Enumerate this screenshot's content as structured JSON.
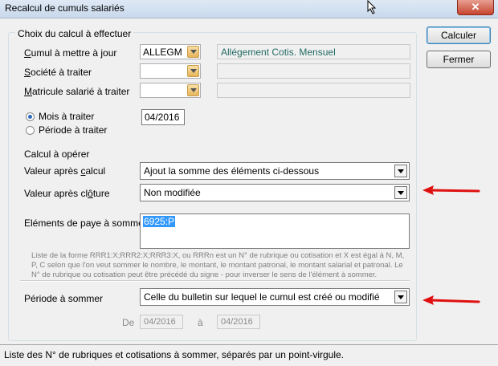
{
  "window": {
    "title": "Recalcul de cumuls salariés",
    "close": "✕"
  },
  "group": {
    "title": "Choix du calcul à effectuer"
  },
  "cumul": {
    "prefix": "C",
    "label": "umul à mettre à jour",
    "value": "ALLEGM",
    "description": "Allégement Cotis. Mensuel"
  },
  "societe": {
    "prefix": "S",
    "label": "ociété à traiter",
    "value": ""
  },
  "matricule": {
    "prefix": "M",
    "label": "atricule salarié à traiter",
    "value": ""
  },
  "radios": {
    "mois": {
      "label": "Mois à traiter",
      "checked": true,
      "value": "04/2016"
    },
    "periode": {
      "label": "Période à traiter",
      "checked": false
    }
  },
  "calcul": {
    "heading": "Calcul à opérer",
    "apres_calcul": {
      "label_a": "Valeur après ",
      "label_u": "c",
      "label_b": "alcul",
      "value": "Ajout la somme des éléments ci-dessous"
    },
    "apres_cloture": {
      "label_a": "Valeur après cl",
      "label_u": "ô",
      "label_b": "ture",
      "value": "Non modifiée"
    }
  },
  "elements": {
    "label": "Eléments de paye à sommer",
    "value": "6925:P",
    "hint": "Liste de la forme RRR1:X;RRR2:X;RRR3:X, ou RRRn est un N° de rubrique ou cotisation et X est égal à N, M, P, C selon que l'on veut sommer le nombre, le montant, le montant patronal, le montant salarial et patronal. Le N° de rubrique ou cotisation peut être précédé du signe - pour inverser le sens de l'élément à sommer."
  },
  "periode_sommer": {
    "label": "Période à sommer",
    "value": "Celle du bulletin sur lequel le cumul est créé ou modifié"
  },
  "range": {
    "de_label": "De",
    "de_value": "04/2016",
    "a_label": "à",
    "a_value": "04/2016"
  },
  "buttons": {
    "calculer": "Calculer",
    "fermer": "Fermer"
  },
  "status": "Liste des N° de rubriques et cotisations à sommer, séparés par un point-virgule.",
  "colors": {
    "annotation_arrow": "#e01010",
    "description_text": "#236b63"
  }
}
